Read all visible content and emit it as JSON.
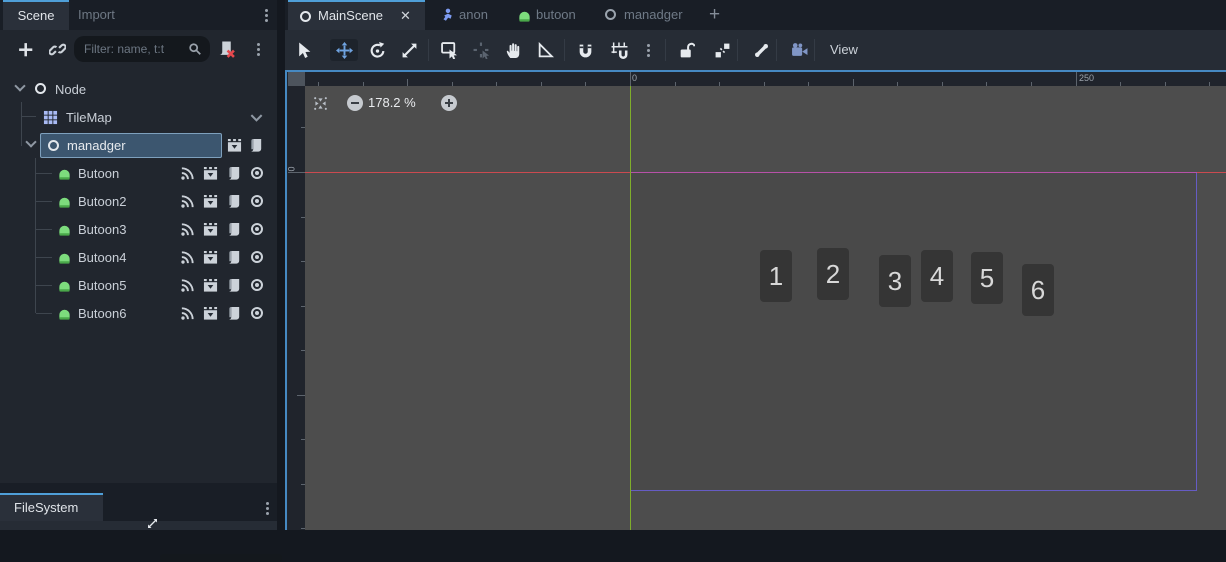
{
  "left_dock": {
    "tabs": {
      "scene": "Scene",
      "import": "Import"
    },
    "filter": {
      "placeholder": "Filter: name, t:t"
    },
    "tree": {
      "root": "Node",
      "tilemap": "TileMap",
      "renaming_value": "manadger",
      "buttons": [
        {
          "label": "Butoon"
        },
        {
          "label": "Butoon2"
        },
        {
          "label": "Butoon3"
        },
        {
          "label": "Butoon4"
        },
        {
          "label": "Butoon5"
        },
        {
          "label": "Butoon6"
        }
      ]
    },
    "filesystem": {
      "tab": "FileSystem"
    }
  },
  "scene_tabs": {
    "main": "MainScene",
    "close_glyph": "✕",
    "anon": "anon",
    "butoon": "butoon",
    "manadger": "manadger",
    "new_tab_glyph": "+"
  },
  "toolbar": {
    "view": "View"
  },
  "canvas": {
    "zoom": "178.2 %",
    "ruler": {
      "h0": "0",
      "h250": "250",
      "v0": "0"
    },
    "buttons": [
      "1",
      "2",
      "3",
      "4",
      "5",
      "6"
    ],
    "colors": {
      "x_axis": "#cb4a50",
      "x_axis_overlap": "#b751a8",
      "y_axis": "#7fae2b",
      "viewport_border": "#665cc4",
      "focus_border": "#4689c2",
      "accent": "#4f9fd8"
    }
  }
}
